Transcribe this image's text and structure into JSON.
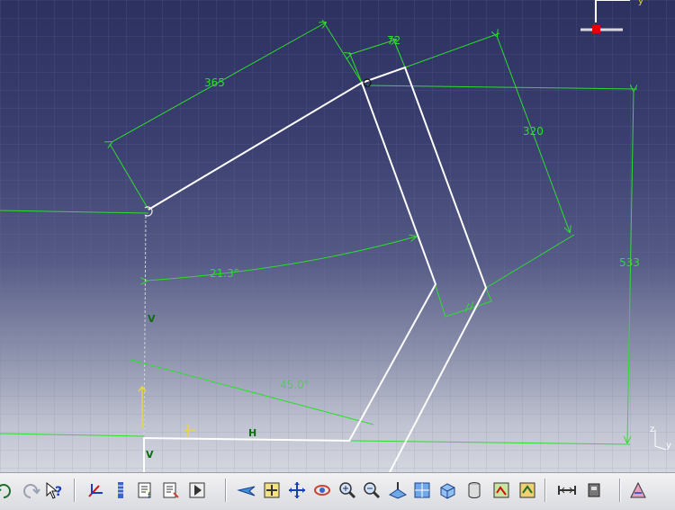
{
  "dimensions": {
    "length_a": "365",
    "thickness": "72",
    "length_b": "320",
    "height": "533",
    "angle_a": "21.3°",
    "angle_b": "45.0°"
  },
  "constraints": {
    "vertical_1": "V",
    "vertical_2": "V",
    "horizontal": "H"
  },
  "compass": {
    "axis_y": "y"
  },
  "axis": {
    "z": "z",
    "y": "y"
  },
  "colors": {
    "sketch": "#ffffff",
    "dimension": "#2fdc2f",
    "constraint": "#0b6e0b",
    "selection": "#e00000"
  },
  "toolbar": {
    "icons": [
      "undo-icon",
      "redo-icon",
      "whats-this-icon",
      "constraint-icon",
      "parameters-icon",
      "formula-icon",
      "formula-edit-icon",
      "publish-icon",
      "fly-mode-icon",
      "fit-all-icon",
      "pan-icon",
      "rotate-icon",
      "zoom-in-icon",
      "zoom-out-icon",
      "normal-view-icon",
      "multi-view-icon",
      "iso-view-icon",
      "render-style-icon",
      "hide-show-icon",
      "swap-visible-icon",
      "measure-icon",
      "catalog-icon",
      "render-icon"
    ]
  }
}
